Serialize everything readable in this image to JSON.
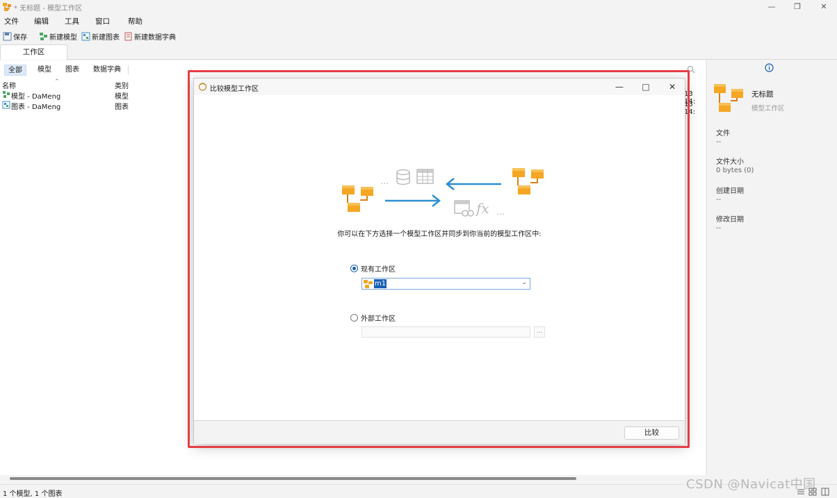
{
  "window": {
    "title": "* 无标题 - 模型工作区",
    "minimize": "—",
    "maximize": "❐",
    "close": "✕"
  },
  "menu": [
    "文件",
    "编辑",
    "工具",
    "窗口",
    "帮助"
  ],
  "toolbar": {
    "save": "保存",
    "new_model": "新建模型",
    "new_chart": "新建图表",
    "new_dictionary": "新建数据字典"
  },
  "tabs": [
    "工作区"
  ],
  "filters": [
    "全部",
    "模型",
    "图表",
    "数据字典"
  ],
  "list": {
    "headers": {
      "name": "名称",
      "kind": "类别"
    },
    "rows": [
      {
        "name": "模型 - DaMeng",
        "kind": "模型",
        "date": "13 14:"
      },
      {
        "name": "图表 - DaMeng",
        "kind": "图表",
        "date": "13 14:"
      }
    ]
  },
  "info": {
    "name": "无标题",
    "type": "模型工作区",
    "props": [
      {
        "label": "文件",
        "value": "--"
      },
      {
        "label": "文件大小",
        "value": "0 bytes (0)"
      },
      {
        "label": "创建日期",
        "value": "--"
      },
      {
        "label": "修改日期",
        "value": "--"
      }
    ]
  },
  "status": {
    "text": "1 个模型, 1 个图表"
  },
  "watermark": "CSDN @Navicat中国",
  "dialog": {
    "title": "比较模型工作区",
    "minimize": "—",
    "maximize": "□",
    "close": "✕",
    "instruction": "你可以在下方选择一个模型工作区并同步到你当前的模型工作区中:",
    "option_existing": "现有工作区",
    "selected_workspace": "m1",
    "option_external": "外部工作区",
    "browse": "...",
    "compare_button": "比较",
    "illus_dots_top": "...",
    "illus_dots_bottom": "...",
    "illus_fx": "fx"
  },
  "colors": {
    "accent": "#1a5fb4",
    "highlight": "#e53d46",
    "model_orange": "#f5a623",
    "arrow_blue": "#2b8fd6"
  }
}
